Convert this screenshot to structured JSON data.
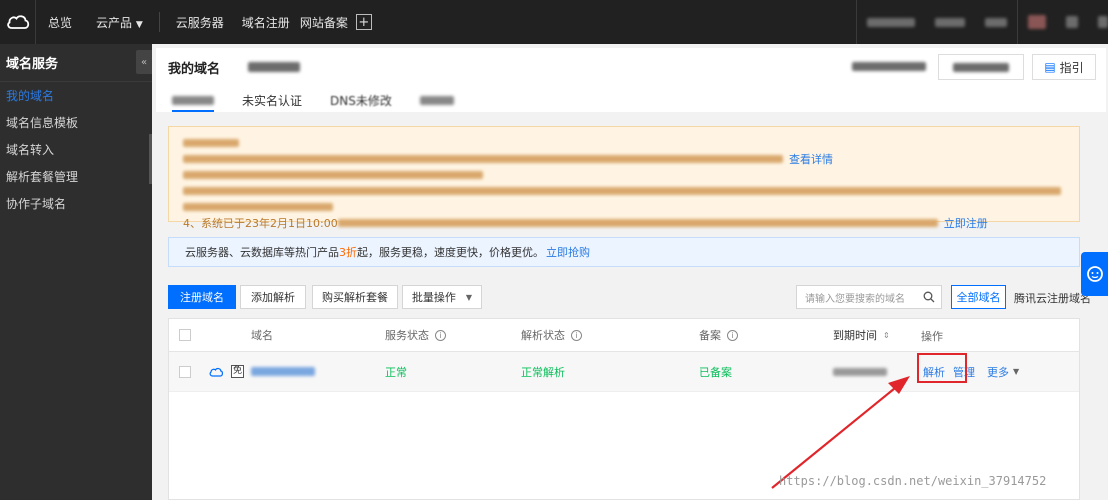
{
  "topbar": {
    "nav": [
      "总览",
      "云产品",
      "云服务器",
      "域名注册",
      "网站备案"
    ],
    "plus": "+"
  },
  "sidebar": {
    "title": "域名服务",
    "collapse": "«",
    "items": [
      "我的域名",
      "域名信息模板",
      "域名转入",
      "解析套餐管理",
      "协作子域名"
    ]
  },
  "header": {
    "title": "我的域名",
    "help_label": "指引",
    "tabs": [
      "未实名认证",
      "DNS未修改",
      ""
    ]
  },
  "notice": {
    "line1_link": "查看详情",
    "line4_prefix": "4、系统已于2",
    "line4_mid": "3年2月1日10:00",
    "line4_link": "立即注册"
  },
  "promo": {
    "prefix": "云服务器、云数据库等热门产品",
    "highlight": "3折",
    "suffix": "起，服务更稳，速度更快，价格更优。",
    "link": "立即抢购"
  },
  "toolbar": {
    "register": "注册域名",
    "add_record": "添加解析",
    "buy_package": "购买解析套餐",
    "batch": "批量操作",
    "search_placeholder": "请输入您要搜索的域名",
    "all_domains": "全部域名",
    "tencent_domains": "腾讯云注册域名"
  },
  "table": {
    "columns": [
      "域名",
      "服务状态",
      "解析状态",
      "备案",
      "到期时间",
      "操作"
    ],
    "rows": [
      {
        "badge": "免",
        "service_status": "正常",
        "dns_status": "正常解析",
        "icp": "已备案",
        "actions": [
          "解析",
          "管理",
          "更多"
        ]
      }
    ]
  },
  "watermark": "https://blog.csdn.net/weixin_37914752",
  "colors": {
    "topbar": "#212121",
    "sidebar": "#2e2e2e",
    "primary": "#006eff",
    "status_green": "#0abf5b",
    "annotation_red": "#e0262b"
  }
}
